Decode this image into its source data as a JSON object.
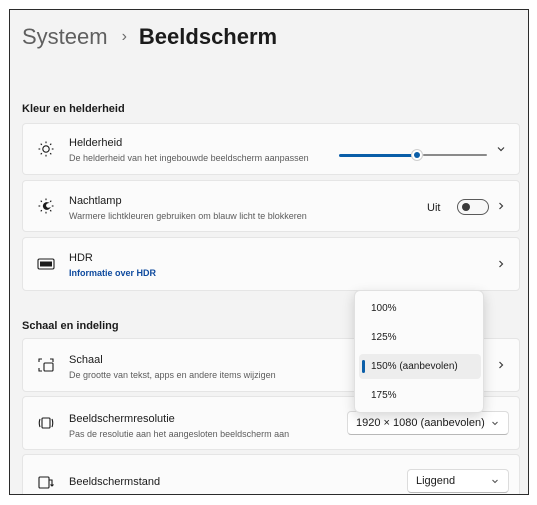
{
  "breadcrumb": {
    "parent": "Systeem",
    "separator": "›",
    "current": "Beeldscherm"
  },
  "sections": {
    "color": "Kleur en helderheid",
    "scale": "Schaal en indeling"
  },
  "brightness": {
    "title": "Helderheid",
    "subtitle": "De helderheid van het ingebouwde beeldscherm aanpassen",
    "value_percent": 53,
    "icon": "sun-icon"
  },
  "night_light": {
    "title": "Nachtlamp",
    "subtitle": "Warmere lichtkleuren gebruiken om blauw licht te blokkeren",
    "state_label": "Uit",
    "enabled": false,
    "icon": "night-light-icon"
  },
  "hdr": {
    "title": "HDR",
    "link": "Informatie over HDR",
    "icon": "hdr-icon"
  },
  "scale": {
    "title": "Schaal",
    "subtitle": "De grootte van tekst, apps en andere items wijzigen",
    "icon": "scale-icon",
    "options": [
      "100%",
      "125%",
      "150% (aanbevolen)",
      "175%"
    ],
    "selected_index": 2
  },
  "resolution": {
    "title": "Beeldschermresolutie",
    "subtitle": "Pas de resolutie aan het aangesloten beeldscherm aan",
    "value": "1920 × 1080 (aanbevolen)",
    "icon": "resolution-icon"
  },
  "orientation": {
    "title": "Beeldschermstand",
    "value": "Liggend",
    "icon": "orientation-icon"
  },
  "colors": {
    "accent": "#0a5ea8",
    "link": "#0e4a9e"
  }
}
